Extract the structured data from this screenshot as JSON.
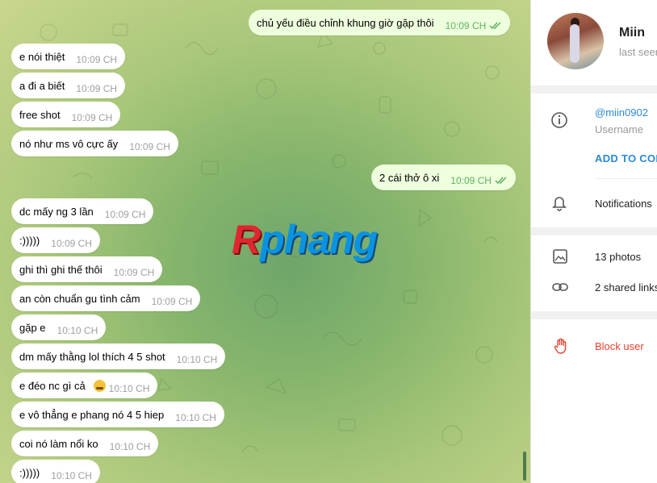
{
  "messages": [
    {
      "text": "chủ yếu điều chỉnh khung giờ gặp thôi",
      "time": "10:09 CH",
      "dir": "out",
      "read": true
    },
    {
      "text": "e nói thiệt",
      "time": "10:09 CH",
      "dir": "in"
    },
    {
      "text": "a đi a biết",
      "time": "10:09 CH",
      "dir": "in"
    },
    {
      "text": "free shot",
      "time": "10:09 CH",
      "dir": "in"
    },
    {
      "text": "nó như ms vô cực ấy",
      "time": "10:09 CH",
      "dir": "in"
    },
    {
      "text": "2 cái thở ô xi",
      "time": "10:09 CH",
      "dir": "out",
      "read": true
    },
    {
      "text": "dc mấy ng 3 lần",
      "time": "10:09 CH",
      "dir": "in"
    },
    {
      "text": ":)))))",
      "time": "10:09 CH",
      "dir": "in"
    },
    {
      "text": "ghi thì ghi thế thôi",
      "time": "10:09 CH",
      "dir": "in"
    },
    {
      "text": "an còn chuẩn gu tình cảm",
      "time": "10:09 CH",
      "dir": "in"
    },
    {
      "text": "gặp e",
      "time": "10:10 CH",
      "dir": "in"
    },
    {
      "text": "dm mấy thằng lol thích 4 5 shot",
      "time": "10:10 CH",
      "dir": "in"
    },
    {
      "text": "e đéo nc gì cả",
      "time": "10:10 CH",
      "dir": "in",
      "emoji": "crying-face-emoji"
    },
    {
      "text": "e vô thẳng e phang nó 4 5 hiep",
      "time": "10:10 CH",
      "dir": "in"
    },
    {
      "text": "coi nó làm nổi ko",
      "time": "10:10 CH",
      "dir": "in"
    },
    {
      "text": ":)))))",
      "time": "10:10 CH",
      "dir": "in"
    }
  ],
  "watermark": "Rphang",
  "profile": {
    "name": "Miin",
    "status": "last seen",
    "username": "@miin0902",
    "username_label": "Username",
    "add_contact": "ADD TO CONTACTS",
    "notifications": "Notifications",
    "photos": "13 photos",
    "links": "2 shared links",
    "block": "Block user"
  },
  "colors": {
    "accent": "#2a8ad2",
    "outgoing_bubble": "#eeffde",
    "danger": "#e5412d",
    "read_check": "#5fb160"
  }
}
